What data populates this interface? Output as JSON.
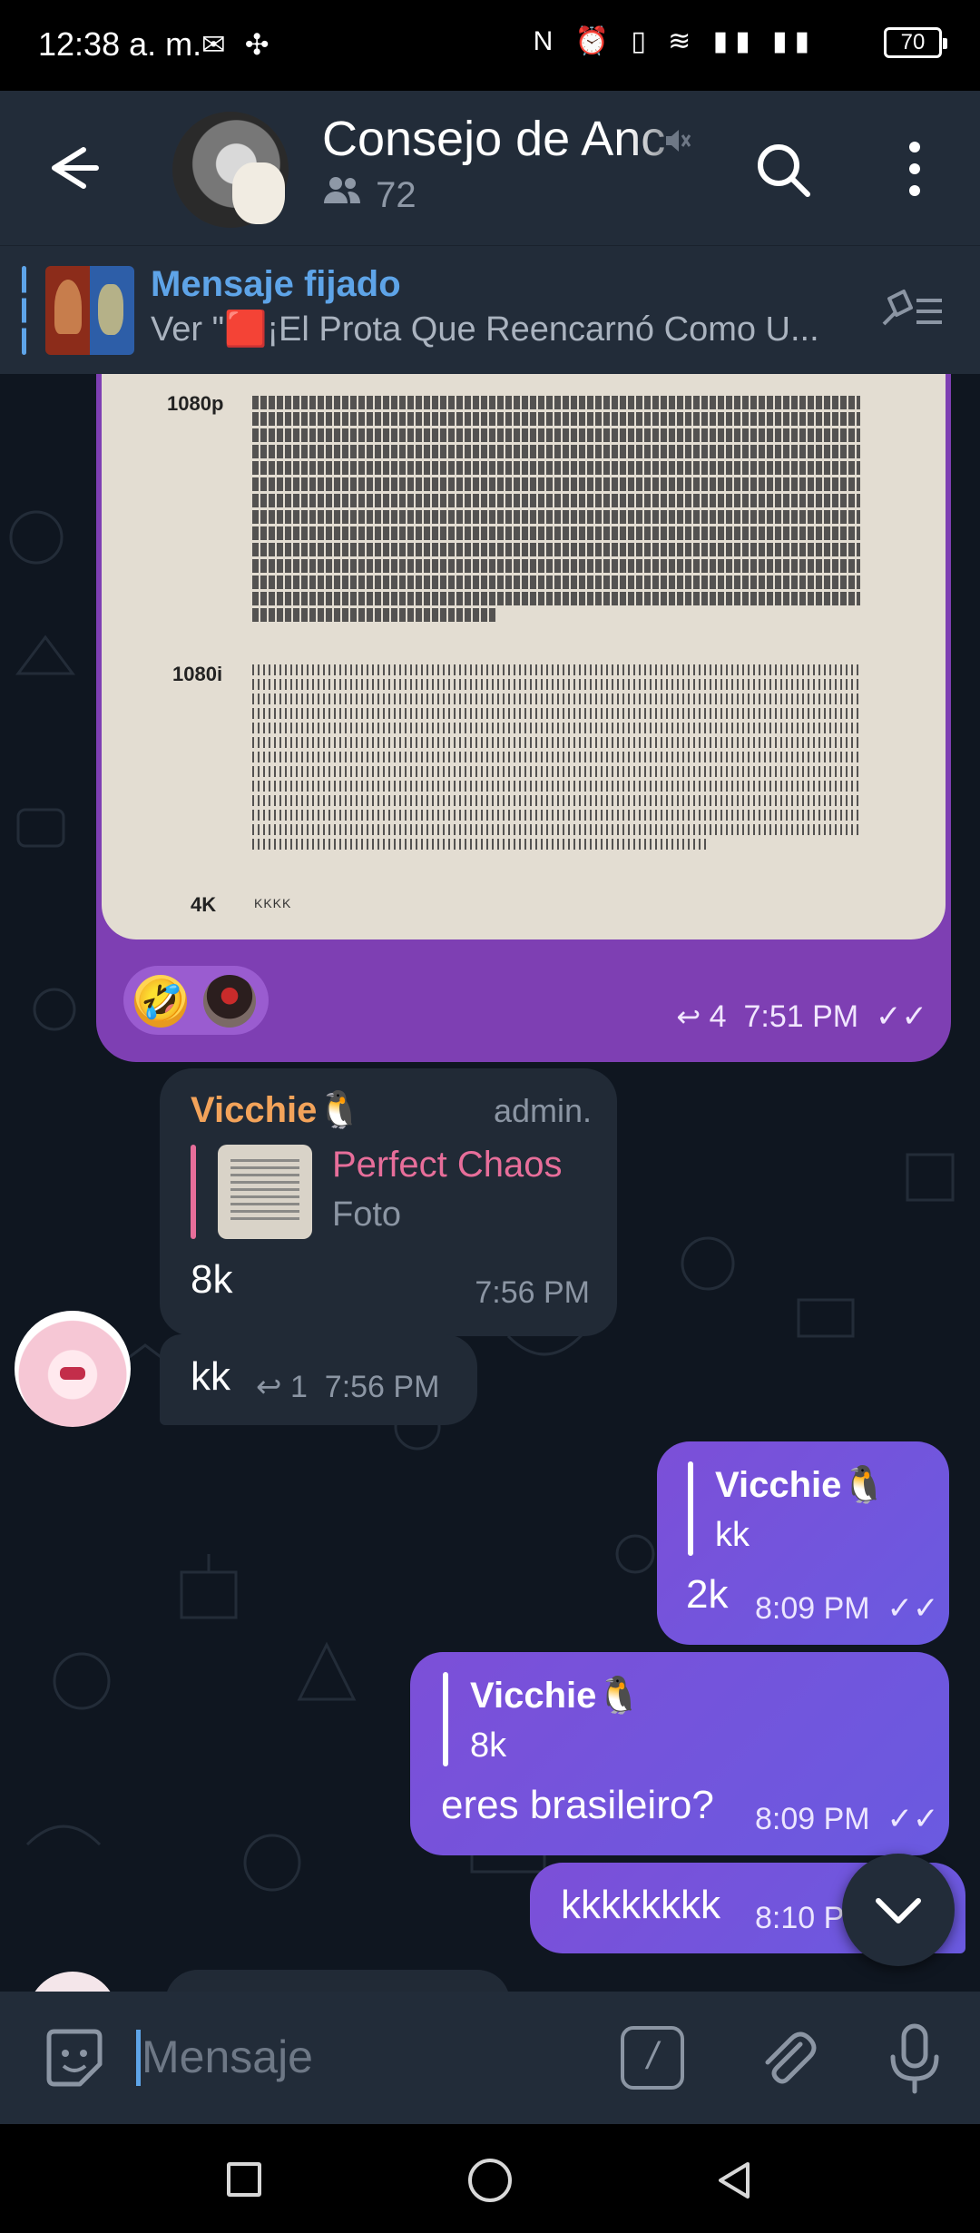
{
  "status_bar": {
    "time": "12:38 a. m.",
    "left_icons": "✉ ✣",
    "right_icons": "N ⏰ ▯ ≋ ▮▮ ▮▮",
    "battery": "70"
  },
  "header": {
    "title": "Consejo de Anc",
    "members_count": "72",
    "icons": [
      "back-arrow-icon",
      "mute-icon",
      "search-icon",
      "more-vert-icon",
      "people-icon"
    ]
  },
  "pinned": {
    "title": "Mensaje fijado",
    "text": "Ver \"🟥¡El Prota Que Reencarnó Como U..."
  },
  "messages": {
    "image_post": {
      "labels": [
        "1080p",
        "1080i",
        "4K"
      ],
      "k_text": "KKKK",
      "reactions": [
        "🤣"
      ],
      "reply_count": "4",
      "time": "7:51 PM",
      "checks": "✓✓"
    },
    "vicchie_msg": {
      "sender": "Vicchie🐧",
      "role": "admin.",
      "quote_name": "Perfect Chaos",
      "quote_type": "Foto",
      "text": "8k",
      "time": "7:56 PM"
    },
    "kk_msg": {
      "text": "kk",
      "reply_count": "1",
      "time": "7:56 PM"
    },
    "out1": {
      "quote_name": "Vicchie🐧",
      "quote_text": "kk",
      "text": "2k",
      "time": "8:09 PM",
      "checks": "✓✓"
    },
    "out2": {
      "quote_name": "Vicchie🐧",
      "quote_text": "8k",
      "text": "eres brasileiro?",
      "time": "8:09 PM",
      "checks": "✓✓"
    },
    "out3": {
      "text": "kkkkkkkk",
      "time": "8:10 P"
    }
  },
  "input": {
    "placeholder": "Mensaje",
    "cmd_symbol": "/"
  },
  "colors": {
    "accent": "#5ea4e8",
    "outgoing": "#7259dc",
    "incoming": "#212a36",
    "admin_name": "#f3a35a",
    "quote_pink": "#e76e9a",
    "header": "#222c39"
  }
}
